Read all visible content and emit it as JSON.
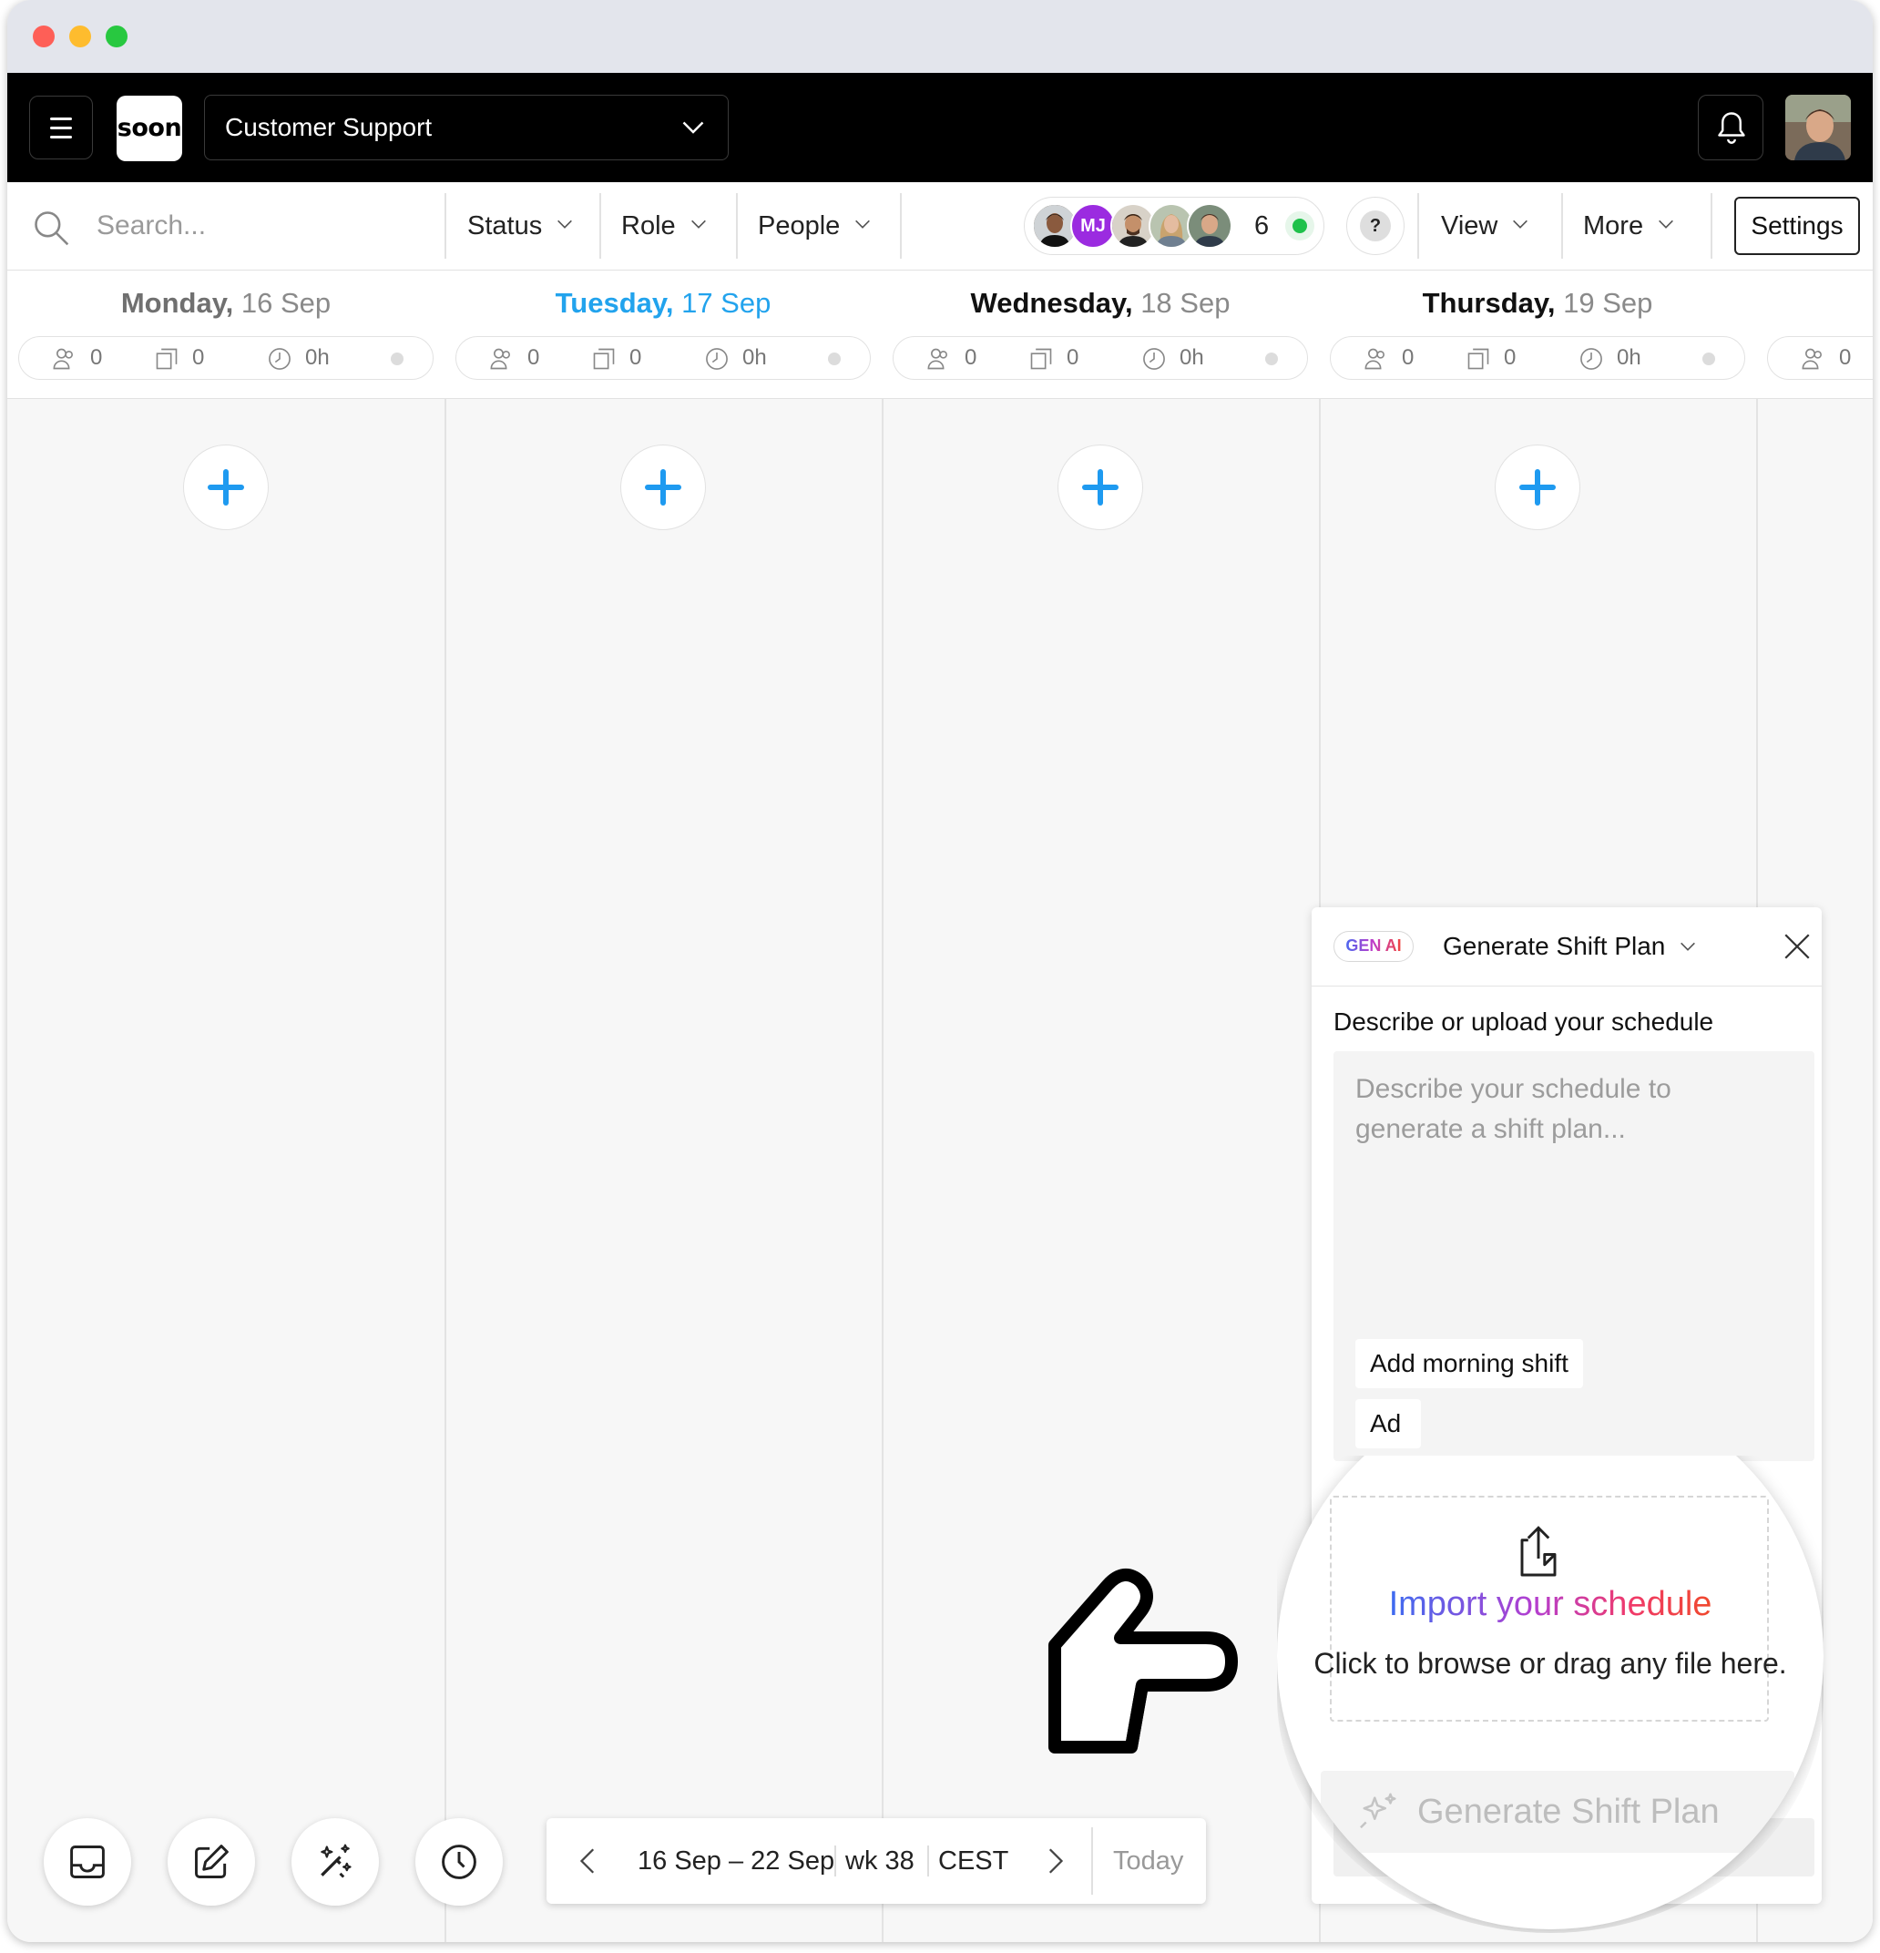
{
  "app": {
    "logo_text": "soon",
    "team": "Customer Support"
  },
  "toolbar": {
    "search_placeholder": "Search...",
    "filters": [
      "Status",
      "Role",
      "People"
    ],
    "avatars": {
      "initials": "MJ",
      "count": "6"
    },
    "help_label": "?",
    "view_label": "View",
    "more_label": "More",
    "settings_label": "Settings"
  },
  "days": [
    {
      "day": "Monday,",
      "date": "16 Sep",
      "people": "0",
      "shifts": "0",
      "hours": "0h"
    },
    {
      "day": "Tuesday,",
      "date": "17 Sep",
      "people": "0",
      "shifts": "0",
      "hours": "0h"
    },
    {
      "day": "Wednesday,",
      "date": "18 Sep",
      "people": "0",
      "shifts": "0",
      "hours": "0h"
    },
    {
      "day": "Thursday,",
      "date": "19 Sep",
      "people": "0",
      "shifts": "0",
      "hours": "0h"
    },
    {
      "day": "",
      "date": "",
      "people": "0",
      "shifts": "",
      "hours": ""
    }
  ],
  "date_nav": {
    "range": "16 Sep – 22 Sep",
    "week": "wk 38",
    "timezone": "CEST",
    "today_label": "Today"
  },
  "panel": {
    "badge": "GEN AI",
    "title": "Generate Shift Plan",
    "label": "Describe or upload your schedule",
    "textarea_placeholder": "Describe your schedule to generate a shift plan...",
    "suggestions": [
      "Add morning shift",
      "Ad"
    ],
    "import_title": "Import your schedule",
    "import_subtitle": "Click to browse or drag any file here.",
    "generate_label": "Generate Shift Plan"
  },
  "colors": {
    "today_accent": "#22a3ed",
    "add_button": "#1e9af0",
    "online": "#1fc14b",
    "avatar_mj": "#9b2be0"
  }
}
